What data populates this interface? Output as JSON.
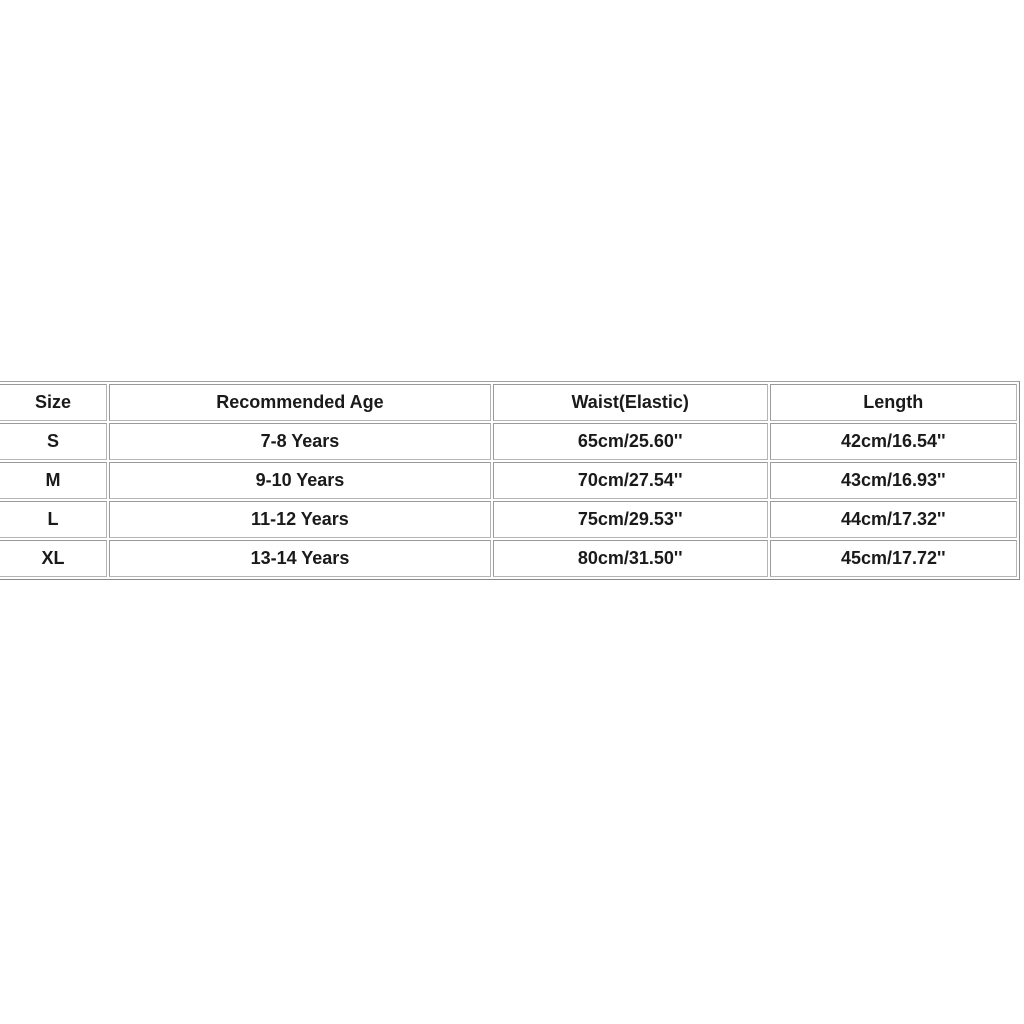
{
  "size_chart": {
    "headers": [
      "Size",
      "Recommended Age",
      "Waist(Elastic)",
      "Length"
    ],
    "rows": [
      [
        "S",
        "7-8 Years",
        "65cm/25.60''",
        "42cm/16.54''"
      ],
      [
        "M",
        "9-10 Years",
        "70cm/27.54''",
        "43cm/16.93''"
      ],
      [
        "L",
        "11-12 Years",
        "75cm/29.53''",
        "44cm/17.32''"
      ],
      [
        "XL",
        "13-14 Years",
        "80cm/31.50''",
        "45cm/17.72''"
      ]
    ]
  }
}
